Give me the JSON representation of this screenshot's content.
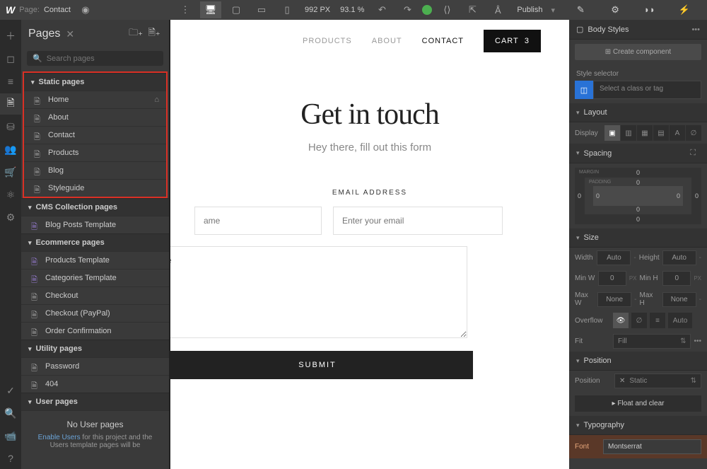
{
  "topbar": {
    "page_label": "Page:",
    "page_name": "Contact",
    "dimensions": "992 PX",
    "zoom": "93.1 %",
    "publish": "Publish"
  },
  "pages_panel": {
    "title": "Pages",
    "search_placeholder": "Search pages",
    "sections": {
      "static": "Static pages",
      "cms": "CMS Collection pages",
      "ecom": "Ecommerce pages",
      "utility": "Utility pages",
      "user": "User pages"
    },
    "static_pages": [
      "Home",
      "About",
      "Contact",
      "Products",
      "Blog",
      "Styleguide"
    ],
    "cms_pages": [
      "Blog Posts Template"
    ],
    "ecom_pages": [
      "Products Template",
      "Categories Template",
      "Checkout",
      "Checkout (PayPal)",
      "Order Confirmation"
    ],
    "utility_pages": [
      "Password",
      "404"
    ],
    "no_user_title": "No User pages",
    "no_user_link": "Enable Users",
    "no_user_text1": " for this project and the Users template pages will be"
  },
  "canvas": {
    "nav": {
      "products": "PRODUCTS",
      "about": "ABOUT",
      "contact": "CONTACT",
      "cart": "CART",
      "cart_count": "3"
    },
    "hero_title": "Get in touch",
    "hero_sub": "Hey there, fill out this form",
    "email_label": "EMAIL ADDRESS",
    "name_ph": "ame",
    "email_ph": "Enter your email",
    "msg_ph": "message",
    "submit": "SUBMIT"
  },
  "right": {
    "body_styles": "Body Styles",
    "create_comp": "Create component",
    "style_selector": "Style selector",
    "selector_ph": "Select a class or tag",
    "layout": "Layout",
    "display": "Display",
    "spacing": "Spacing",
    "margin": "MARGIN",
    "padding": "PADDING",
    "sp_vals": {
      "t": "0",
      "r": "0",
      "b": "0",
      "l": "0",
      "pt": "0",
      "pr": "0",
      "pb": "0",
      "pl": "0"
    },
    "size": "Size",
    "width": "Width",
    "height": "Height",
    "minw": "Min W",
    "minh": "Min H",
    "maxw": "Max W",
    "maxh": "Max H",
    "auto": "Auto",
    "none": "None",
    "zero": "0",
    "px": "PX",
    "overflow": "Overflow",
    "fit": "Fit",
    "fill": "Fill",
    "position": "Position",
    "position_section": "Position",
    "static": "Static",
    "float": "Float and clear",
    "typography": "Typography",
    "font": "Font",
    "font_val": "Montserrat"
  }
}
